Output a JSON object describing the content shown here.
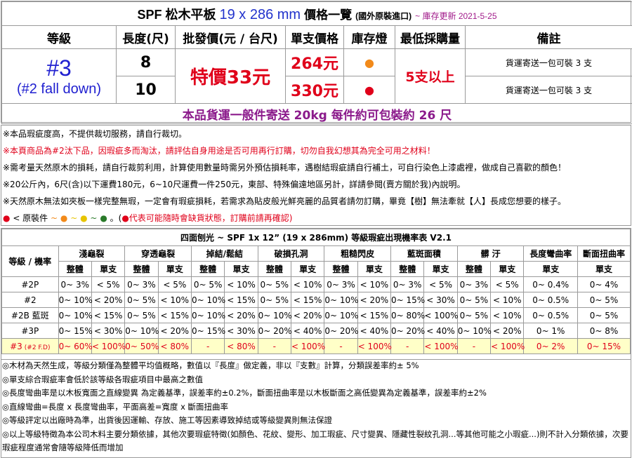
{
  "header": {
    "title_prefix": "SPF 松木平板",
    "dimension": "19 x 286 mm",
    "title_suffix": "價格一覽",
    "origin": "(國外原裝進口)",
    "updated": "~ 庫存更新 2021-5-25"
  },
  "columns": [
    "等級",
    "長度(尺)",
    "批發價(元 / 台尺)",
    "單支價格",
    "庫存燈",
    "最低採購量",
    "備註"
  ],
  "grade": {
    "main": "#3",
    "sub": "(#2 fall down)"
  },
  "wholesale_price": "特價33元",
  "moq": "5支以上",
  "rows": [
    {
      "length": "8",
      "unit_price": "264元",
      "stock_color": "#f28a1a",
      "stock_icon": "●",
      "note": "貨運寄送一包可裝 3 支"
    },
    {
      "length": "10",
      "unit_price": "330元",
      "stock_color": "#e0001a",
      "stock_icon": "●",
      "note": "貨運寄送一包可裝 3 支"
    }
  ],
  "shipping": "本品貨運一般件寄送 20kg 每件約可包裝約 26 尺",
  "notes": [
    "※本品瑕疵度高，不提供裁切服務，請自行裁切。",
    "※本頁商品為#2汰下品，因瑕疵多而淘汰，請評估自身用途是否可用再行訂購，切勿自我幻想其為完全可用之材料！",
    "※需考量天然原木的損耗，請自行裁剪利用，計算使用數量時需另外預估損耗率，遇樹結瑕疵請自行補土，可自行染色上漆處裡，做成自己喜歡的顏色！",
    "※20公斤內，6尺(含)以下運費180元，6~10尺運費一件250元，東部、特殊偏遠地區另計，詳請參閱(賣方關於我)內說明。",
    "※天然原木無法如夾板一樣完整無瑕，一定會有瑕疵損耗，若需求為貼皮般光鮮亮麗的品質者請勿訂購，畢竟【樹】無法牽就【人】長成您想要的樣子。"
  ],
  "legend": {
    "prefix": "●",
    "label": "< 原裝件",
    "tilde1": "~",
    "d2": "●",
    "tilde2": "~",
    "d3": "●",
    "tilde3": "~",
    "d4": "●",
    "suffix": "。(",
    "warn_dot": "●",
    "warn": "代表可能隨時會缺貨狀態，訂購前請再確認)"
  },
  "defect_table": {
    "title": "四面刨光 ~ SPF 1x 12”  (19 x 286mm) 等級瑕疵出現機率表 V2.1",
    "corner": "等級 / 機率",
    "groups": [
      "淺龜裂",
      "穿透龜裂",
      "掉結/鬆結",
      "破損孔洞",
      "粗糙閃皮",
      "藍斑面積",
      "髒 汙",
      "長度彎曲率",
      "斷面扭曲率"
    ],
    "sub_a": "整體",
    "sub_b": "單支",
    "rows": [
      {
        "grade": "#2P",
        "cells": [
          "0~ 3%",
          "< 5%",
          "0~ 3%",
          "< 5%",
          "0~ 5%",
          "< 10%",
          "0~ 5%",
          "< 10%",
          "0~ 3%",
          "< 10%",
          "0~ 3%",
          "< 5%",
          "0~ 3%",
          "< 5%",
          "0~ 0.4%",
          "0~ 4%"
        ]
      },
      {
        "grade": "#2",
        "cells": [
          "0~ 10%",
          "< 20%",
          "0~ 5%",
          "< 10%",
          "0~ 10%",
          "< 15%",
          "0~ 5%",
          "< 15%",
          "0~ 10%",
          "< 20%",
          "0~ 15%",
          "< 30%",
          "0~ 5%",
          "< 10%",
          "0~ 0.5%",
          "0~ 5%"
        ]
      },
      {
        "grade": "#2B 藍斑",
        "cells": [
          "0~ 10%",
          "< 15%",
          "0~ 5%",
          "< 15%",
          "0~ 10%",
          "< 20%",
          "0~ 10%",
          "< 20%",
          "0~ 10%",
          "< 15%",
          "0~ 80%",
          "< 100%",
          "0~ 5%",
          "< 10%",
          "0~ 0.5%",
          "0~ 5%"
        ]
      },
      {
        "grade": "#3P",
        "cells": [
          "0~ 15%",
          "< 30%",
          "0~ 10%",
          "< 20%",
          "0~ 15%",
          "< 30%",
          "0~ 20%",
          "< 40%",
          "0~ 20%",
          "< 40%",
          "0~ 20%",
          "< 40%",
          "0~ 10%",
          "< 20%",
          "0~ 1%",
          "0~ 8%"
        ]
      },
      {
        "grade": "#3",
        "grade_small": "(#2 F.D)",
        "cells": [
          "0~ 60%",
          "< 100%",
          "0~ 50%",
          "< 80%",
          "-",
          "< 80%",
          "-",
          "< 100%",
          "-",
          "< 100%",
          "-",
          "< 100%",
          "-",
          "< 100%",
          "0~ 2%",
          "0~ 15%"
        ]
      }
    ]
  },
  "footer_notes": [
    "◎木材為天然生成，等級分類僅為整體平均值概略，數值以『長度』做定義，非以『支數』計算，分類誤差率約± 5%",
    "◎單支綜合瑕疵率會低於該等級各瑕疵項目中最高之數值",
    "◎長度彎曲率是以木板寬面之直線變異 為定義基準，誤差率約±0.2%，斷面扭曲率是以木板斷面之高低變異為定義基準，誤差率約±2%",
    "◎直線彎曲=長度 x 長度彎曲率，平面高差=寬度 x 斷面扭曲率",
    "◎等級評定以出廠時為準，出貨後因運輸、存放、施工等因素導致掉結或等級變異則無法保證",
    "◎以上等級特徵為本公司木料主要分類依據，其他次要瑕疵特徵(如顏色、花紋、變形、加工瑕疵、尺寸變異、隱藏性裂紋孔洞...等其他可能之小瑕疵...)則不計入分類依據，次要瑕疵程度通常會隨等級降低而增加"
  ]
}
